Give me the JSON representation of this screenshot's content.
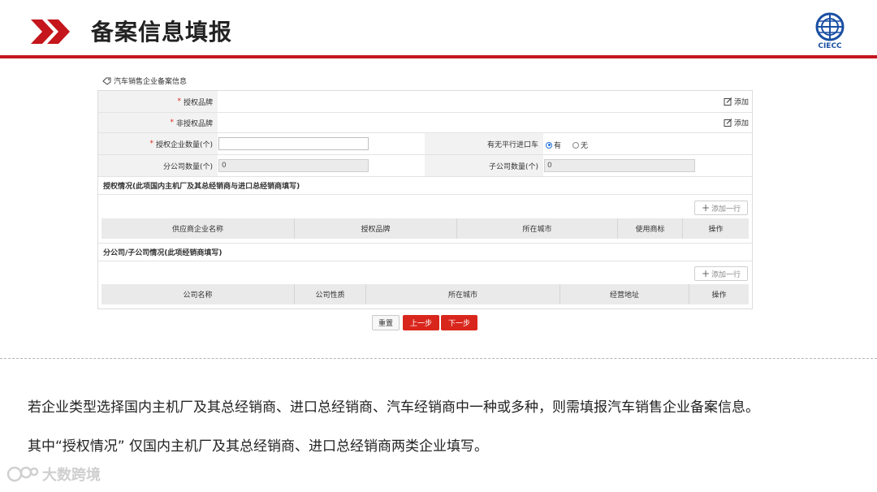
{
  "header": {
    "title": "备案信息填报",
    "logo_text": "CIECC",
    "accent_color": "#c4161c"
  },
  "section": {
    "label": "汽车销售企业备案信息",
    "icon": "tag-icon"
  },
  "form": {
    "authorized_brand_label": "授权品牌",
    "unauthorized_brand_label": "非授权品牌",
    "add_label": "添加",
    "authorized_count_label": "授权企业数量(个)",
    "authorized_count_value": "",
    "parallel_import_label": "有无平行进口车",
    "parallel_yes": "有",
    "parallel_no": "无",
    "parallel_selected": "有",
    "branch_count_label": "分公司数量(个)",
    "branch_count_value": "0",
    "sub_count_label": "子公司数量(个)",
    "sub_count_value": "0"
  },
  "auth_section": {
    "title": "授权情况(此项国内主机厂及其总经销商与进口总经销商填写)",
    "add_row": "添加一行",
    "columns": [
      "供应商企业名称",
      "授权品牌",
      "所在城市",
      "使用商标",
      "操作"
    ]
  },
  "branch_section": {
    "title": "分公司/子公司情况(此项经销商填写)",
    "add_row": "添加一行",
    "columns": [
      "公司名称",
      "公司性质",
      "所在城市",
      "经营地址",
      "操作"
    ]
  },
  "buttons": {
    "reset": "重置",
    "prev": "上一步",
    "next": "下一步"
  },
  "notes": {
    "line1": "若企业类型选择国内主机厂及其总经销商、进口总经销商、汽车经销商中一种或多种，则需填报汽车销售企业备案信息。",
    "line2": "其中“授权情况” 仅国内主机厂及其总经销商、进口总经销商两类企业填写。"
  },
  "watermark": "大数跨境"
}
